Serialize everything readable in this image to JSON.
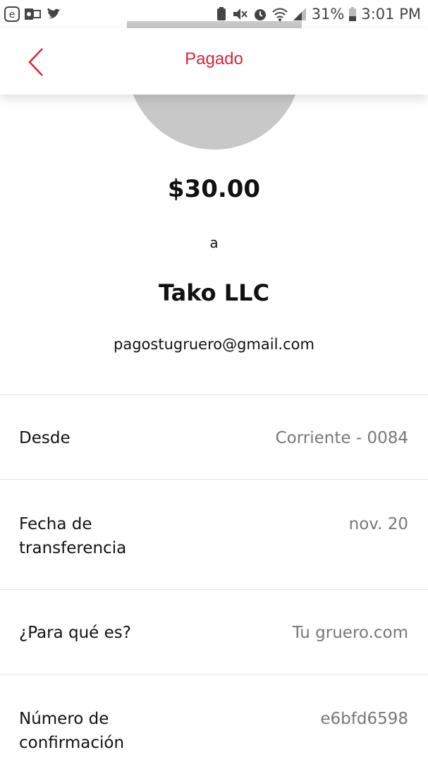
{
  "status_bar": {
    "left_icons": [
      "edge-icon",
      "outlook-icon",
      "twitter-icon"
    ],
    "right_icons": [
      "usb-icon",
      "mute-icon",
      "alarm-icon",
      "wifi-icon",
      "signal-icon"
    ],
    "battery": "31%",
    "time": "3:01 PM"
  },
  "header": {
    "title": "Pagado",
    "accent_color": "#d9243c"
  },
  "payment": {
    "amount": "$30.00",
    "to_label": "a",
    "recipient": "Tako LLC",
    "email": "pagostugruero@gmail.com"
  },
  "details": [
    {
      "label": "Desde",
      "value": "Corriente - 0084"
    },
    {
      "label": "Fecha de transferencia",
      "value": "nov. 20"
    },
    {
      "label": "¿Para qué es?",
      "value": "Tu gruero.com"
    },
    {
      "label": "Número de confirmación",
      "value": "e6bfd6598"
    }
  ]
}
